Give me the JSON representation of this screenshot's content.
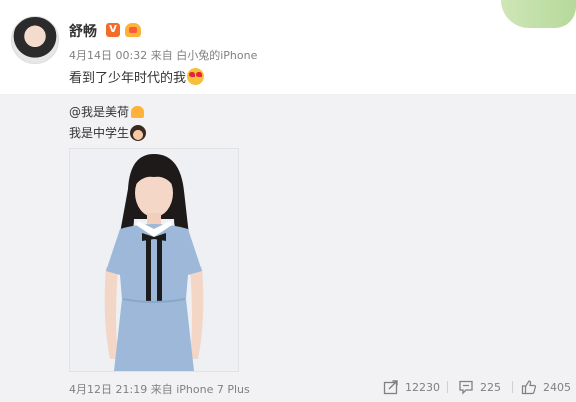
{
  "post": {
    "author": "舒畅",
    "verified_badge": "V",
    "time": "4月14日 00:32",
    "source_prefix": "来自",
    "source": "白小兔的iPhone",
    "text": "看到了少年时代的我"
  },
  "repost": {
    "author": "@我是美荷",
    "text": "我是中学生",
    "time": "4月12日 21:19",
    "source_prefix": "来自",
    "source": "iPhone 7 Plus",
    "actions": {
      "share_count": "12230",
      "comment_count": "225",
      "like_count": "2405"
    }
  },
  "colors": {
    "repost_background": "#f2f2f5",
    "meta_text": "#808080",
    "verified_orange": "#f26d2b"
  },
  "icons": [
    "verified-icon",
    "level-badge-icon",
    "heart-eyes-emoji",
    "girl-emoji",
    "share-icon",
    "comment-icon",
    "like-icon"
  ]
}
